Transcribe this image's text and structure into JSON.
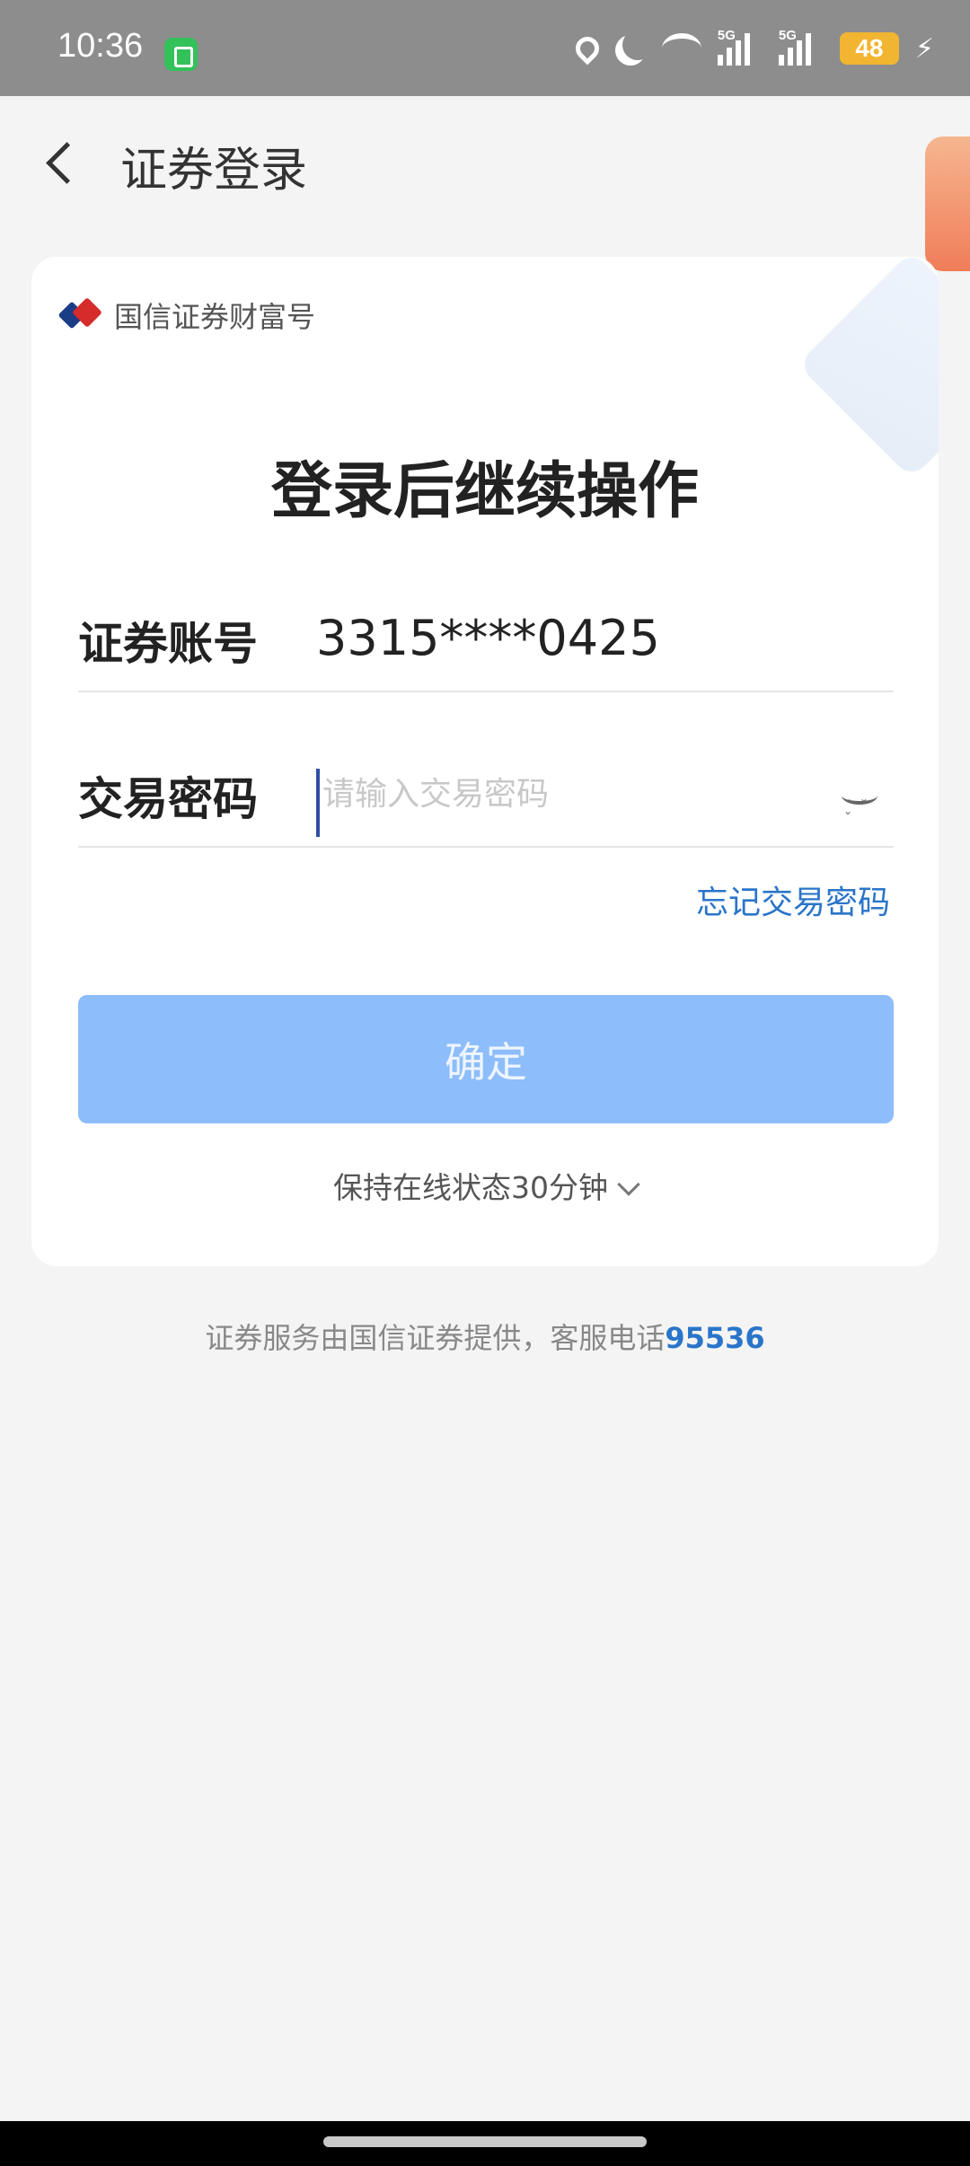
{
  "status_bar": {
    "time": "10:36",
    "signal1_label": "5G",
    "signal2_label": "5G",
    "battery": "48",
    "icons": [
      "app-badge-icon",
      "location-icon",
      "moon-icon",
      "wifi-icon",
      "signal-icon",
      "signal-icon",
      "battery-icon",
      "charging-icon"
    ]
  },
  "header": {
    "title": "证券登录"
  },
  "card": {
    "brand": "国信证券财富号",
    "heading": "登录后继续操作",
    "account_label": "证券账号",
    "account_value": "3315****0425",
    "password_label": "交易密码",
    "password_placeholder": "请输入交易密码",
    "forgot": "忘记交易密码",
    "confirm": "确定",
    "keep_online": "保持在线状态30分钟"
  },
  "footer": {
    "text": "证券服务由国信证券提供，客服电话",
    "phone": "95536"
  },
  "colors": {
    "accent": "#2a75c9",
    "button": "#8dbdfb",
    "statusbar": "#8d8d8d",
    "background": "#f4f4f4"
  }
}
